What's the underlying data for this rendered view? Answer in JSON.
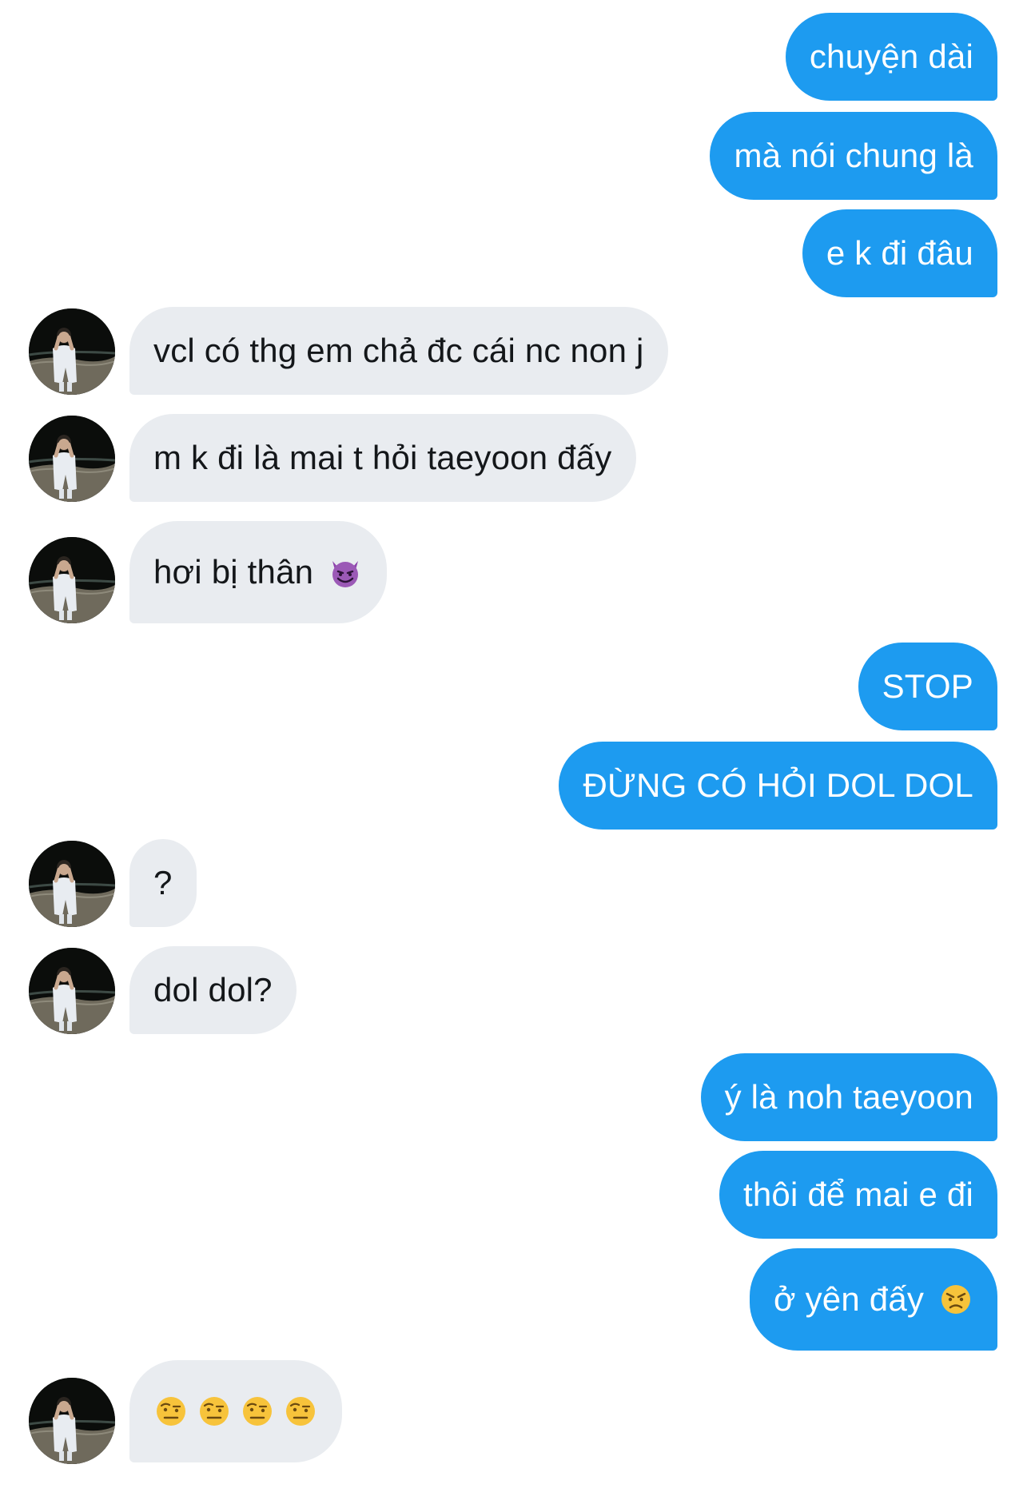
{
  "messages": [
    {
      "dir": "out",
      "text": "chuyện dài"
    },
    {
      "dir": "out",
      "text": "mà nói chung là"
    },
    {
      "dir": "out",
      "text": "e k đi đâu"
    },
    {
      "dir": "in",
      "text": "vcl có thg em chả đc cái nc non j"
    },
    {
      "dir": "in",
      "text": "m k đi là mai t hỏi taeyoon đấy"
    },
    {
      "dir": "in",
      "text": "hơi bị thân",
      "emoji": "smiling-devil-emoji"
    },
    {
      "dir": "out",
      "text": "STOP"
    },
    {
      "dir": "out",
      "text": "ĐỪNG CÓ HỎI DOL DOL"
    },
    {
      "dir": "in",
      "text": "?"
    },
    {
      "dir": "in",
      "text": "dol dol?"
    },
    {
      "dir": "out",
      "text": "ý là noh taeyoon"
    },
    {
      "dir": "out",
      "text": "thôi để mai e đi"
    },
    {
      "dir": "out",
      "text": "ở yên đấy",
      "emoji": "angry-face-emoji"
    },
    {
      "dir": "in",
      "text": "",
      "emojis": [
        "raised-eyebrow-emoji",
        "raised-eyebrow-emoji",
        "raised-eyebrow-emoji",
        "raised-eyebrow-emoji"
      ]
    }
  ],
  "colors": {
    "outgoing_bubble": "#1d9bf0",
    "incoming_bubble": "#e9ecf0",
    "outgoing_text": "#ffffff",
    "incoming_text": "#14171a"
  },
  "avatar_icon": "user-avatar-photo"
}
